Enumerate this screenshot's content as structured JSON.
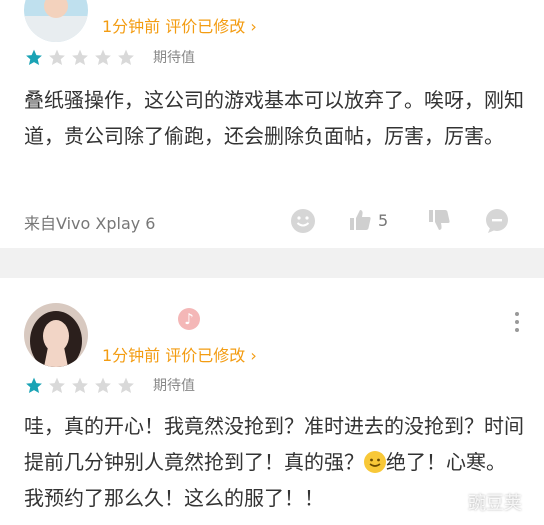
{
  "reviews": [
    {
      "username": "",
      "meta": "1分钟前 评价已修改 ›",
      "rating": 1,
      "rating_label": "期待值",
      "content": "叠纸骚操作，这公司的游戏基本可以放弃了。唉呀，刚知道，贵公司除了偷跑，还会删除负面帖，厉害，厉害。",
      "device": "来自Vivo Xplay 6",
      "likes": "5"
    },
    {
      "username": "",
      "meta": "1分钟前 评价已修改 ›",
      "rating": 1,
      "rating_label": "期待值",
      "content_part1": "哇，真的开心！我竟然没抢到？准时进去的没抢到？时间提前几分钟别人竟然抢到了！真的强？",
      "content_part2": "绝了！心寒。我预约了那么久！这么的服了！！"
    }
  ],
  "colors": {
    "star_filled": "#1aa3b5",
    "star_empty": "#d9d9d9",
    "meta": "#f39c12"
  },
  "icons": [
    "smile-icon",
    "thumbs-up-icon",
    "thumbs-down-icon",
    "comment-icon",
    "more-vertical-icon",
    "emoji-icon"
  ]
}
